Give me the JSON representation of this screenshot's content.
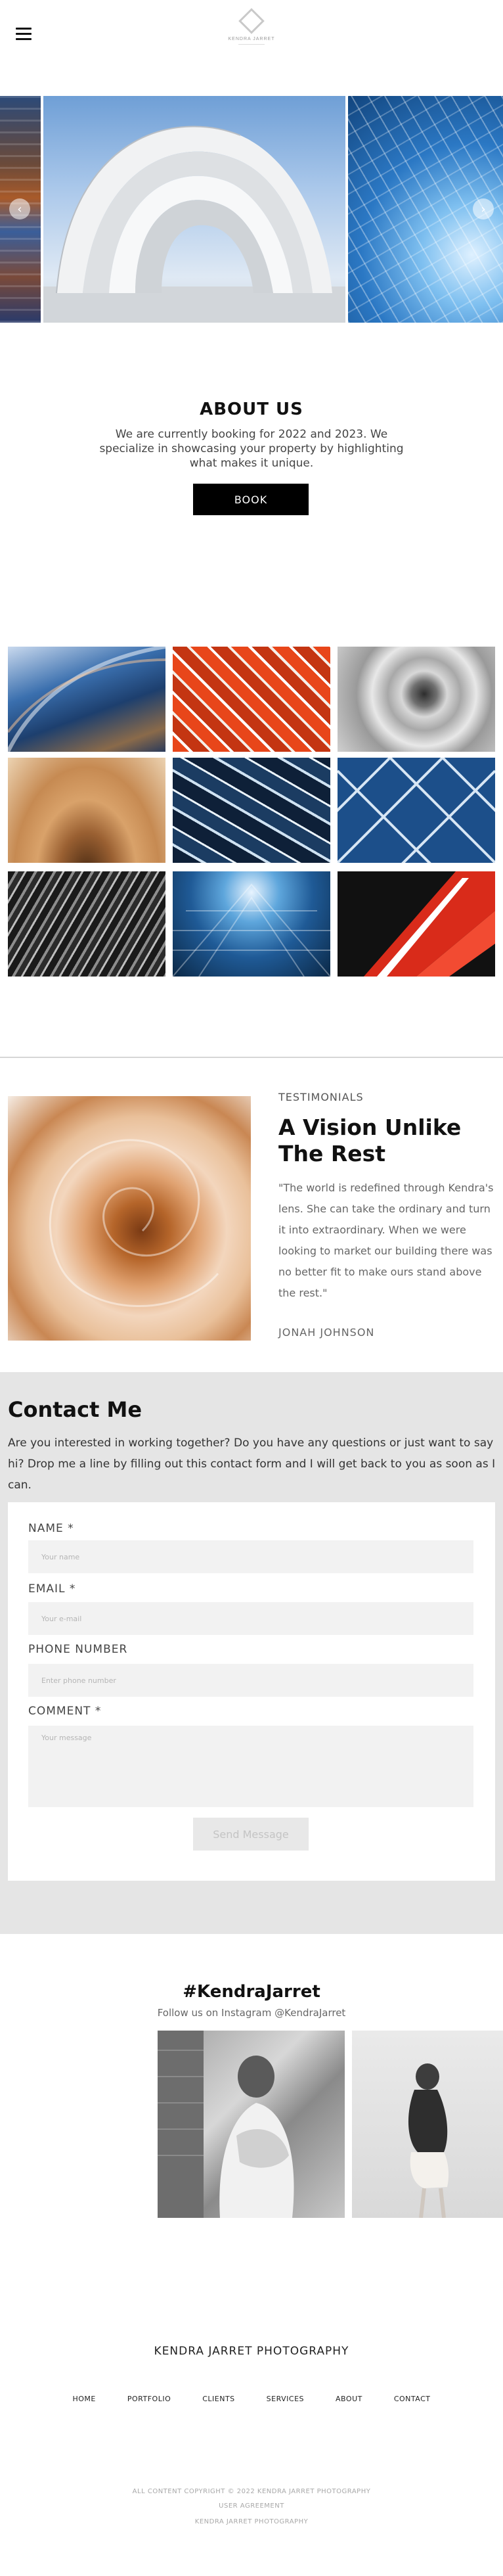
{
  "header": {
    "menu_icon": "hamburger-icon",
    "logo_text": "KENDRA JARRET",
    "logo_icon": "diamond-logo-icon"
  },
  "hero": {
    "prev_icon": "chevron-left-icon",
    "next_icon": "chevron-right-icon",
    "prev_glyph": "‹",
    "next_glyph": "›"
  },
  "about": {
    "title": "ABOUT US",
    "text": "We are currently booking for 2022 and 2023. We specialize in showcasing your property by highlighting what makes it unique.",
    "button": "BOOK"
  },
  "testimonials": {
    "label": "TESTIMONIALS",
    "title": "A Vision Unlike The Rest",
    "quote": "\"The world is redefined through Kendra's lens.  She can take the ordinary and turn it into extraordinary. When we were looking to market our building there was no better fit to make ours stand above the rest.\"",
    "author": "JONAH JOHNSON"
  },
  "contact": {
    "title": "Contact Me",
    "intro": "Are you interested in working together? Do you have any questions or just want to say hi? Drop me a line by filling out this contact form and I will get back to you as soon as I can.",
    "fields": [
      {
        "label": "NAME *",
        "placeholder": "Your name"
      },
      {
        "label": "EMAIL *",
        "placeholder": "Your e-mail"
      },
      {
        "label": "PHONE NUMBER",
        "placeholder": "Enter phone number"
      },
      {
        "label": "COMMENT *",
        "placeholder": "Your message"
      }
    ],
    "submit": "Send Message"
  },
  "instagram": {
    "hashtag": "#KendraJarret",
    "subtitle": "Follow us on Instagram @KendraJarret"
  },
  "footer": {
    "brand": "KENDRA JARRET PHOTOGRAPHY",
    "nav": [
      "HOME",
      "PORTFOLIO",
      "CLIENTS",
      "SERVICES",
      "ABOUT",
      "CONTACT"
    ],
    "copyright": "ALL CONTENT COPYRIGHT © 2022 KENDRA JARRET PHOTOGRAPHY",
    "user_agreement": "USER AGREEMENT",
    "credit": "KENDRA JARRET PHOTOGRAPHY"
  }
}
